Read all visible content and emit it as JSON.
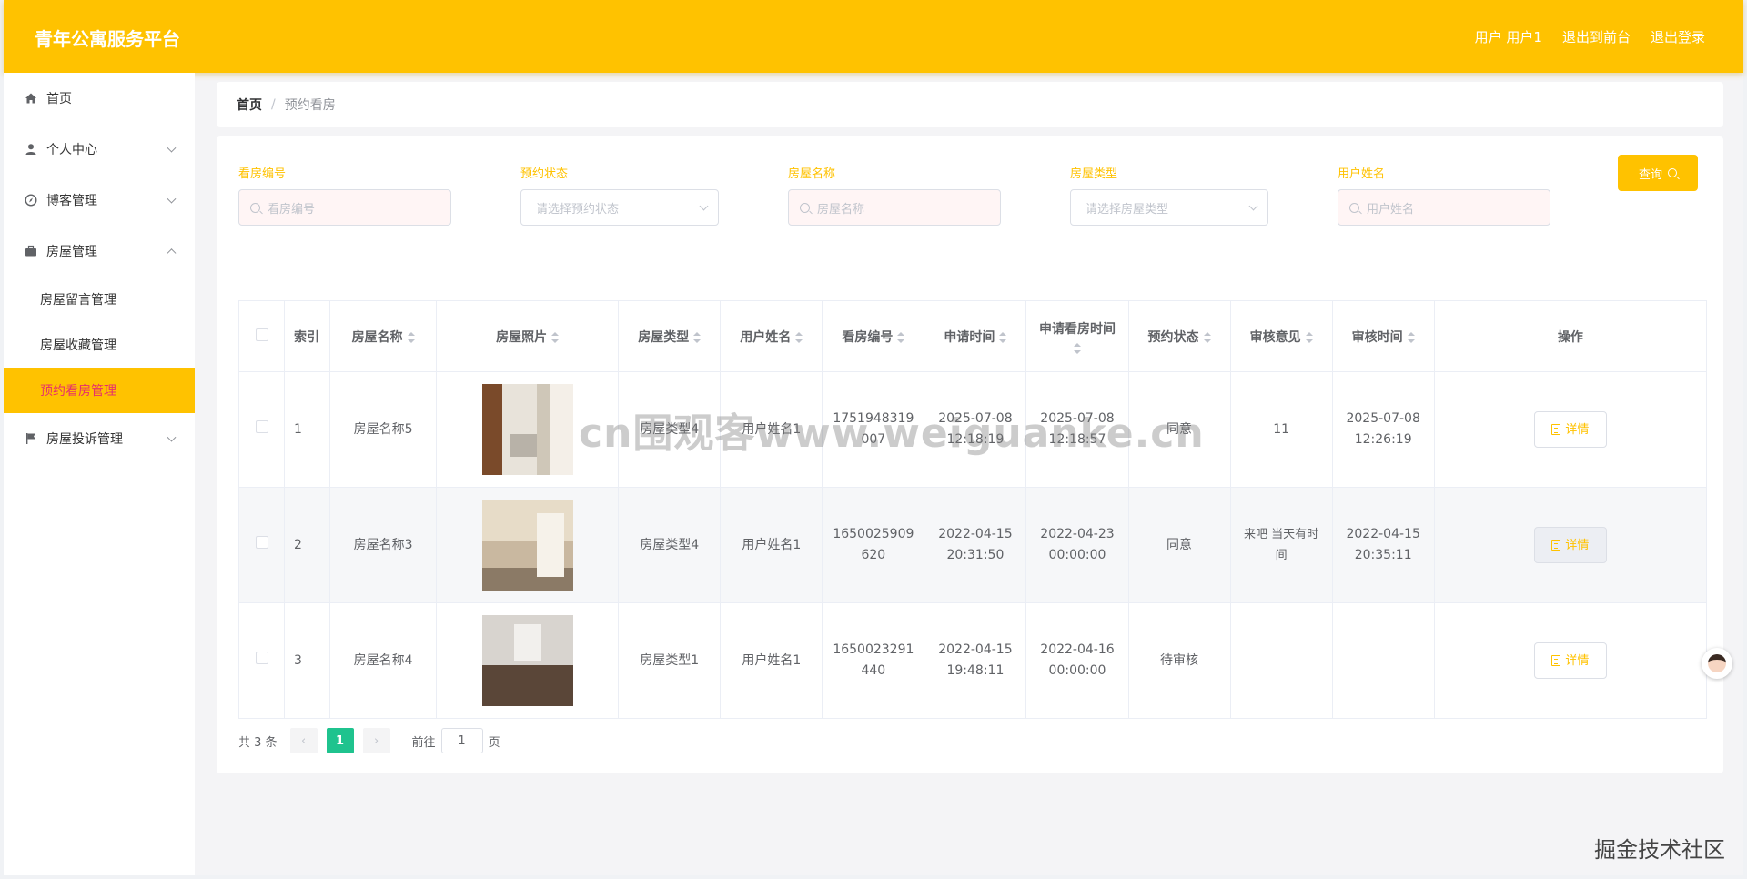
{
  "header": {
    "brand": "青年公寓服务平台",
    "links": [
      "用户 用户1",
      "退出到前台",
      "退出登录"
    ],
    "accent_color": "#ffc200"
  },
  "sidebar": {
    "items": [
      {
        "label": "首页",
        "icon": "home-icon"
      },
      {
        "label": "个人中心",
        "icon": "user-icon"
      },
      {
        "label": "博客管理",
        "icon": "compass-icon"
      },
      {
        "label": "房屋管理",
        "icon": "briefcase-icon"
      },
      {
        "label": "房屋投诉管理",
        "icon": "flag-icon"
      }
    ],
    "sub_items": [
      "房屋留言管理",
      "房屋收藏管理",
      "预约看房管理"
    ],
    "active": "预约看房管理"
  },
  "breadcrumb": {
    "home": "首页",
    "sep": "/",
    "current": "预约看房"
  },
  "filters": [
    {
      "label": "看房编号",
      "placeholder": "看房编号"
    },
    {
      "label": "预约状态",
      "placeholder": "请选择预约状态"
    },
    {
      "label": "房屋名称",
      "placeholder": "房屋名称"
    },
    {
      "label": "房屋类型",
      "placeholder": "请选择房屋类型"
    },
    {
      "label": "用户姓名",
      "placeholder": "用户姓名"
    }
  ],
  "query_label": "查询",
  "table": {
    "headers": [
      "索引",
      "房屋名称",
      "房屋照片",
      "房屋类型",
      "用户姓名",
      "看房编号",
      "申请时间",
      "申请看房时间",
      "预约状态",
      "审核意见",
      "审核时间",
      "操作"
    ],
    "rows": [
      {
        "index": "1",
        "name": "房屋名称5",
        "type": "房屋类型4",
        "user": "用户姓名1",
        "code": "1751948319007",
        "apply_time": "2025-07-08 12:18:19",
        "view_time": "2025-07-08 12:18:57",
        "status": "同意",
        "opinion": "11",
        "review_time": "2025-07-08 12:26:19"
      },
      {
        "index": "2",
        "name": "房屋名称3",
        "type": "房屋类型4",
        "user": "用户姓名1",
        "code": "1650025909620",
        "apply_time": "2022-04-15 20:31:50",
        "view_time": "2022-04-23 00:00:00",
        "status": "同意",
        "opinion": "来吧 当天有时间",
        "review_time": "2022-04-15 20:35:11"
      },
      {
        "index": "3",
        "name": "房屋名称4",
        "type": "房屋类型1",
        "user": "用户姓名1",
        "code": "1650023291440",
        "apply_time": "2022-04-15 19:48:11",
        "view_time": "2022-04-16 00:00:00",
        "status": "待审核",
        "opinion": "",
        "review_time": ""
      }
    ],
    "detail_label": "详情"
  },
  "pagination": {
    "total": "共 3 条",
    "current_page": "1",
    "goto_label": "前往",
    "goto_value": "1",
    "page_suffix": "页"
  },
  "watermark": "cn围观客www.weiguanke.cn",
  "footer_mark": "掘金技术社区"
}
